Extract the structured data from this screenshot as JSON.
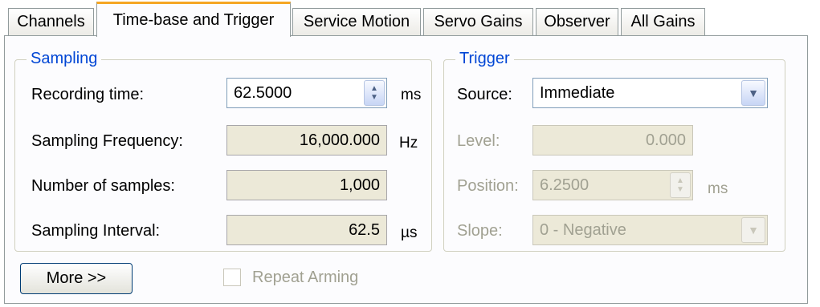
{
  "tabs": [
    {
      "label": "Channels"
    },
    {
      "label": "Time-base and Trigger",
      "active": true
    },
    {
      "label": "Service Motion"
    },
    {
      "label": "Servo Gains"
    },
    {
      "label": "Observer"
    },
    {
      "label": "All Gains"
    }
  ],
  "sampling": {
    "title": "Sampling",
    "recording_time": {
      "label": "Recording time:",
      "value": "62.5000",
      "unit": "ms"
    },
    "sampling_frequency": {
      "label": "Sampling Frequency:",
      "value": "16,000.000",
      "unit": "Hz"
    },
    "number_of_samples": {
      "label": "Number of samples:",
      "value": "1,000"
    },
    "sampling_interval": {
      "label": "Sampling Interval:",
      "value": "62.5",
      "unit": "µs"
    }
  },
  "trigger": {
    "title": "Trigger",
    "source": {
      "label": "Source:",
      "value": "Immediate"
    },
    "level": {
      "label": "Level:",
      "value": "0.000"
    },
    "position": {
      "label": "Position:",
      "value": "6.2500",
      "unit": "ms"
    },
    "slope": {
      "label": "Slope:",
      "value": "0 - Negative"
    }
  },
  "more_button": {
    "label": "More >>"
  },
  "repeat_arming": {
    "label": "Repeat Arming",
    "checked": false,
    "enabled": false
  },
  "colors": {
    "accent": "#0046d5",
    "active_tab_highlight": "#f5a623",
    "readonly_bg": "#ece9d8"
  },
  "icons": {
    "spin": "spin-up-down-icon",
    "dropdown": "chevron-down-icon"
  }
}
